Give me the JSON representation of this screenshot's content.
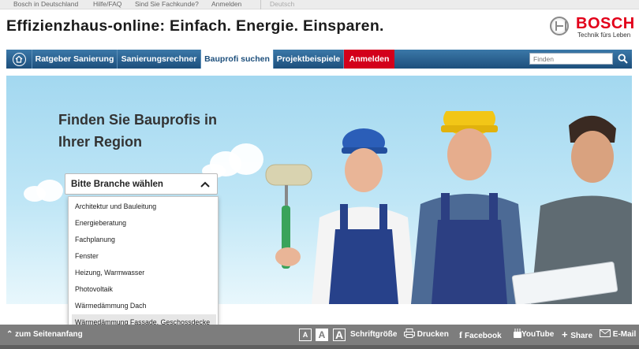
{
  "topbar": {
    "links": [
      "Bosch in Deutschland",
      "Hilfe/FAQ",
      "Sind Sie Fachkunde?",
      "Anmelden"
    ],
    "language": "Deutsch"
  },
  "header": {
    "title": "Effizienzhaus-online: Einfach. Energie. Einsparen.",
    "brand": "BOSCH",
    "tagline": "Technik fürs Leben"
  },
  "nav": {
    "items": [
      "Ratgeber Sanierung",
      "Sanierungsrechner",
      "Bauprofi suchen",
      "Projektbeispiele",
      "Anmelden"
    ],
    "active_index": 2,
    "search_placeholder": "Finden"
  },
  "hero": {
    "title_line1": "Finden Sie Bauprofis in",
    "title_line2": "Ihrer Region",
    "select_label": "Bitte Branche wählen",
    "options": [
      "Architektur und Bauleitung",
      "Energieberatung",
      "Fachplanung",
      "Fenster",
      "Heizung, Warmwasser",
      "Photovoltaik",
      "Wärmedämmung Dach",
      "Wärmedämmung Fassade, Geschossdecke"
    ],
    "highlighted_index": 7
  },
  "footer": {
    "back_to_top": "zum Seitenanfang",
    "font_size_label": "Schriftgröße",
    "font_sizes": [
      "A",
      "A",
      "A"
    ],
    "print": "Drucken",
    "facebook": "Facebook",
    "youtube": "YouTube",
    "share": "Share",
    "email": "E-Mail"
  },
  "colors": {
    "nav_blue": "#1d4f7c",
    "bosch_red": "#e2001a",
    "sky": "#bfe6f6",
    "footer_gray": "#7d7d7d"
  },
  "icons": [
    "home-icon",
    "search-icon",
    "chevron-up-icon",
    "print-icon",
    "facebook-icon",
    "youtube-icon",
    "share-plus-icon",
    "mail-icon"
  ]
}
